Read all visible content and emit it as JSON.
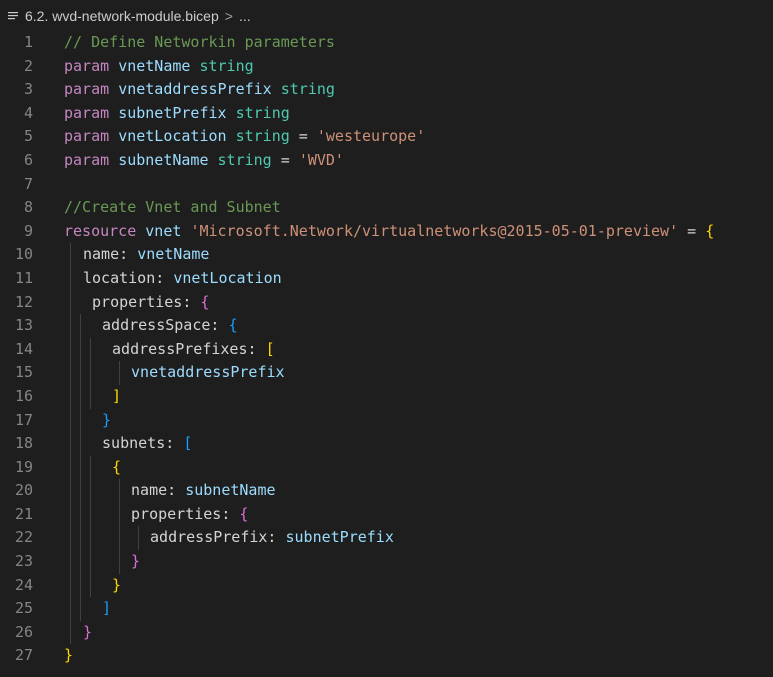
{
  "breadcrumb": {
    "file_name": "6.2. wvd-network-module.bicep",
    "separator": ">",
    "tail": "...",
    "icon": "list-lines-icon"
  },
  "code_lines": [
    {
      "n": "1",
      "indent": 0,
      "tokens": [
        [
          "c",
          "// Define Networkin parameters"
        ]
      ]
    },
    {
      "n": "2",
      "indent": 0,
      "tokens": [
        [
          "k",
          "param"
        ],
        [
          "p",
          " "
        ],
        [
          "v",
          "vnetName"
        ],
        [
          "p",
          " "
        ],
        [
          "t",
          "string"
        ]
      ]
    },
    {
      "n": "3",
      "indent": 0,
      "tokens": [
        [
          "k",
          "param"
        ],
        [
          "p",
          " "
        ],
        [
          "v",
          "vnetaddressPrefix"
        ],
        [
          "p",
          " "
        ],
        [
          "t",
          "string"
        ]
      ]
    },
    {
      "n": "4",
      "indent": 0,
      "tokens": [
        [
          "k",
          "param"
        ],
        [
          "p",
          " "
        ],
        [
          "v",
          "subnetPrefix"
        ],
        [
          "p",
          " "
        ],
        [
          "t",
          "string"
        ]
      ]
    },
    {
      "n": "5",
      "indent": 0,
      "tokens": [
        [
          "k",
          "param"
        ],
        [
          "p",
          " "
        ],
        [
          "v",
          "vnetLocation"
        ],
        [
          "p",
          " "
        ],
        [
          "t",
          "string"
        ],
        [
          "p",
          " = "
        ],
        [
          "s",
          "'westeurope'"
        ]
      ]
    },
    {
      "n": "6",
      "indent": 0,
      "tokens": [
        [
          "k",
          "param"
        ],
        [
          "p",
          " "
        ],
        [
          "v",
          "subnetName"
        ],
        [
          "p",
          " "
        ],
        [
          "t",
          "string"
        ],
        [
          "p",
          " = "
        ],
        [
          "s",
          "'WVD'"
        ]
      ]
    },
    {
      "n": "7",
      "indent": 0,
      "tokens": []
    },
    {
      "n": "8",
      "indent": 0,
      "tokens": [
        [
          "c",
          "//Create Vnet and Subnet"
        ]
      ]
    },
    {
      "n": "9",
      "indent": 0,
      "tokens": [
        [
          "k",
          "resource"
        ],
        [
          "p",
          " "
        ],
        [
          "v",
          "vnet"
        ],
        [
          "p",
          " "
        ],
        [
          "s",
          "'Microsoft.Network/virtualnetworks@2015-05-01-preview'"
        ],
        [
          "p",
          " = "
        ],
        [
          "br1",
          "{"
        ]
      ]
    },
    {
      "n": "10",
      "indent": 1,
      "tokens": [
        [
          "p",
          "name: "
        ],
        [
          "v",
          "vnetName"
        ]
      ]
    },
    {
      "n": "11",
      "indent": 1,
      "tokens": [
        [
          "p",
          "location: "
        ],
        [
          "v",
          "vnetLocation"
        ]
      ]
    },
    {
      "n": "12",
      "indent": 1,
      "tokens": [
        [
          "p",
          " properties: "
        ],
        [
          "br2",
          "{"
        ]
      ]
    },
    {
      "n": "13",
      "indent": 2,
      "tokens": [
        [
          "p",
          " addressSpace: "
        ],
        [
          "br3",
          "{"
        ]
      ]
    },
    {
      "n": "14",
      "indent": 3,
      "tokens": [
        [
          "p",
          " addressPrefixes: "
        ],
        [
          "br1",
          "["
        ]
      ]
    },
    {
      "n": "15",
      "indent": 4,
      "tokens": [
        [
          "p",
          " "
        ],
        [
          "v",
          "vnetaddressPrefix"
        ]
      ]
    },
    {
      "n": "16",
      "indent": 3,
      "tokens": [
        [
          "p",
          " "
        ],
        [
          "br1",
          "]"
        ]
      ]
    },
    {
      "n": "17",
      "indent": 2,
      "tokens": [
        [
          "p",
          " "
        ],
        [
          "br3",
          "}"
        ]
      ]
    },
    {
      "n": "18",
      "indent": 2,
      "tokens": [
        [
          "p",
          " subnets: "
        ],
        [
          "br3",
          "["
        ]
      ]
    },
    {
      "n": "19",
      "indent": 3,
      "tokens": [
        [
          "p",
          " "
        ],
        [
          "br1",
          "{"
        ]
      ]
    },
    {
      "n": "20",
      "indent": 4,
      "tokens": [
        [
          "p",
          " name: "
        ],
        [
          "v",
          "subnetName"
        ]
      ]
    },
    {
      "n": "21",
      "indent": 4,
      "tokens": [
        [
          "p",
          " properties: "
        ],
        [
          "br2",
          "{"
        ]
      ]
    },
    {
      "n": "22",
      "indent": 5,
      "tokens": [
        [
          "p",
          " addressPrefix: "
        ],
        [
          "v",
          "subnetPrefix"
        ]
      ]
    },
    {
      "n": "23",
      "indent": 4,
      "tokens": [
        [
          "p",
          " "
        ],
        [
          "br2",
          "}"
        ]
      ]
    },
    {
      "n": "24",
      "indent": 3,
      "tokens": [
        [
          "p",
          " "
        ],
        [
          "br1",
          "}"
        ]
      ]
    },
    {
      "n": "25",
      "indent": 2,
      "tokens": [
        [
          "p",
          " "
        ],
        [
          "br3",
          "]"
        ]
      ]
    },
    {
      "n": "26",
      "indent": 1,
      "tokens": [
        [
          "br2",
          "}"
        ]
      ]
    },
    {
      "n": "27",
      "indent": 0,
      "tokens": [
        [
          "br1",
          "}"
        ]
      ]
    }
  ]
}
